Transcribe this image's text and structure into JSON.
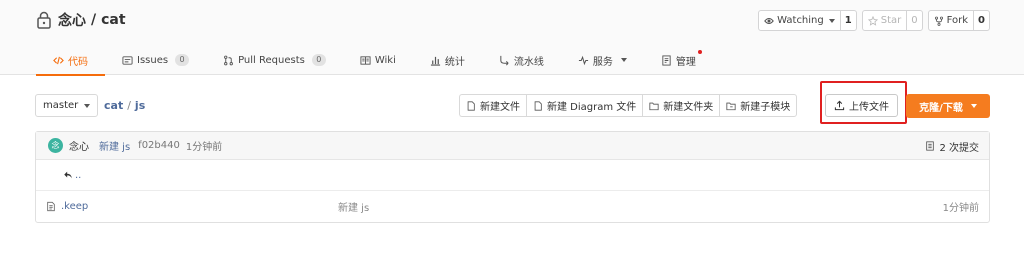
{
  "repo": {
    "owner": "念心",
    "separator": "/",
    "name": "cat"
  },
  "repo_actions": {
    "watch_label": "Watching",
    "watch_count": "1",
    "star_label": "Star",
    "star_count": "0",
    "fork_label": "Fork",
    "fork_count": "0"
  },
  "tabs": [
    {
      "label": "代码",
      "badge": null
    },
    {
      "label": "Issues",
      "badge": "0"
    },
    {
      "label": "Pull Requests",
      "badge": "0"
    },
    {
      "label": "Wiki",
      "badge": null
    },
    {
      "label": "统计",
      "badge": null
    },
    {
      "label": "流水线",
      "badge": null
    },
    {
      "label": "服务",
      "badge": null
    },
    {
      "label": "管理",
      "badge": null
    }
  ],
  "toolbar": {
    "branch": "master",
    "path_repo": "cat",
    "path_sep": "/",
    "path_dir": "js",
    "new_file": "新建文件",
    "new_diagram": "新建 Diagram 文件",
    "new_folder": "新建文件夹",
    "new_submodule": "新建子模块",
    "upload": "上传文件",
    "clone": "克隆/下载"
  },
  "commit": {
    "avatar_text": "念",
    "author": "念心",
    "message": "新建 js",
    "hash": "f02b440",
    "time": "1分钟前",
    "count": "2 次提交"
  },
  "files": {
    "parent": "..",
    "rows": [
      {
        "name": ".keep",
        "message": "新建 js",
        "time": "1分钟前"
      }
    ]
  },
  "colors": {
    "accent": "#f56c0b",
    "clone_button": "#f57c1f",
    "highlight_box": "#e02020",
    "link": "#4f6b9b"
  }
}
